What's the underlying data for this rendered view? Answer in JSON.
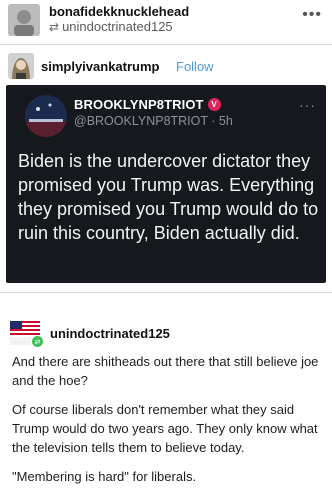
{
  "header": {
    "author": "bonafidekknucklehead",
    "reblog_from": "unindoctrinated125",
    "reblog_icon": "⇄",
    "more_icon": "•••"
  },
  "source": {
    "name": "simplyivankatrump",
    "follow_label": "Follow",
    "follow_color": "#4b9be0"
  },
  "tweet": {
    "name": "BROOKLYNP8TRIOT",
    "badge": "V",
    "handle_line": "@BROOKLYNP8TRIOT · 5h",
    "more_icon": "···",
    "text": "Biden is the undercover dictator they promised you Trump was. Everything they promised you Trump would do to ruin this country, Biden actually did.",
    "background": "#15191d"
  },
  "reply": {
    "name": "unindoctrinated125",
    "paragraphs": [
      "And there are shitheads out there that still believe joe and the hoe?",
      "Of course liberals don't remember what they said Trump would do two years ago. They only know what the television tells them to believe today.",
      "\"Membering is hard\" for liberals."
    ]
  }
}
